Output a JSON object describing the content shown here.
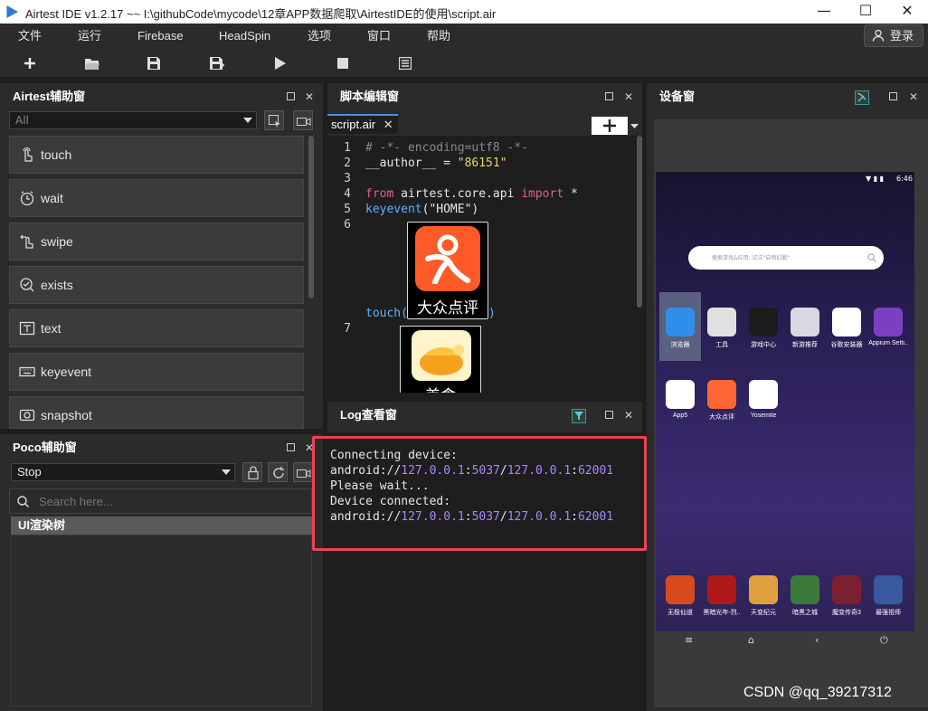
{
  "window": {
    "title": "Airtest IDE v1.2.17 ~~ I:\\githubCode\\mycode\\12章APP数据爬取\\AirtestIDE的使用\\script.air",
    "minimize": "—",
    "maximize": "☐",
    "close": "✕"
  },
  "menu": {
    "items": [
      "文件",
      "运行",
      "Firebase",
      "HeadSpin",
      "选项",
      "窗口",
      "帮助"
    ],
    "login": "登录"
  },
  "airtest_panel": {
    "title": "Airtest辅助窗",
    "filter": "All",
    "commands": [
      "touch",
      "wait",
      "swipe",
      "exists",
      "text",
      "keyevent",
      "snapshot"
    ]
  },
  "poco_panel": {
    "title": "Poco辅助窗",
    "mode": "Stop",
    "search_placeholder": "Search here...",
    "tree_root": "UI渲染树"
  },
  "editor": {
    "title": "脚本编辑窗",
    "tab": "script.air",
    "line_numbers": [
      "1",
      "2",
      "3",
      "4",
      "5",
      "6",
      "7"
    ],
    "line1": "# -*- encoding=utf8 -*-",
    "line2_a": "__author__ = ",
    "line2_b": "\"86151\"",
    "line4_kw1": "from",
    "line4_mod": " airtest.core.api ",
    "line4_kw2": "import",
    "line4_star": " *",
    "line5_fn": "keyevent",
    "line5_arg": "(\"HOME\")",
    "touch_fn": "touch(",
    "touch_close": ")",
    "img1_label": "大众点评",
    "img2_label": "美食"
  },
  "log": {
    "title": "Log查看窗",
    "line1": "Connecting device:",
    "line2_prefix": "android://",
    "line2_ip1": "127.0.0.1",
    "line2_port1": "5037",
    "line2_ip2": "127.0.0.1",
    "line2_port2": "62001",
    "line3": "Please wait...",
    "line4": "Device connected:",
    "colon": ":",
    "slash": "/"
  },
  "device": {
    "title": "设备窗",
    "time": "6:46",
    "search_placeholder": "搜索游戏&应用, 试试\"启明幻歌\"",
    "apps_row1": [
      {
        "label": "浏览器",
        "color": "#2f8fe8"
      },
      {
        "label": "工具",
        "color": "#e0e0e0"
      },
      {
        "label": "游戏中心",
        "color": "#1c1c1c"
      },
      {
        "label": "新游推荐",
        "color": "#d8d8e0"
      },
      {
        "label": "谷歌安装器",
        "color": "#ffffff"
      },
      {
        "label": "Appium Setti..",
        "color": "#7b3fc4"
      }
    ],
    "apps_row2": [
      {
        "label": "App5",
        "color": "#ffffff"
      },
      {
        "label": "大众点评",
        "color": "#ff6633"
      },
      {
        "label": "Yosemite",
        "color": "#ffffff"
      }
    ],
    "apps_dock": [
      {
        "label": "无极仙道",
        "color": "#d84a1c"
      },
      {
        "label": "黑暗光年-烈..",
        "color": "#b01818"
      },
      {
        "label": "天变纪元",
        "color": "#e0a040"
      },
      {
        "label": "暗黑之城",
        "color": "#3c7a3a"
      },
      {
        "label": "魔变传奇3",
        "color": "#7a2030"
      },
      {
        "label": "最强祖师",
        "color": "#3a5aa0"
      }
    ]
  },
  "watermark": "CSDN @qq_39217312"
}
